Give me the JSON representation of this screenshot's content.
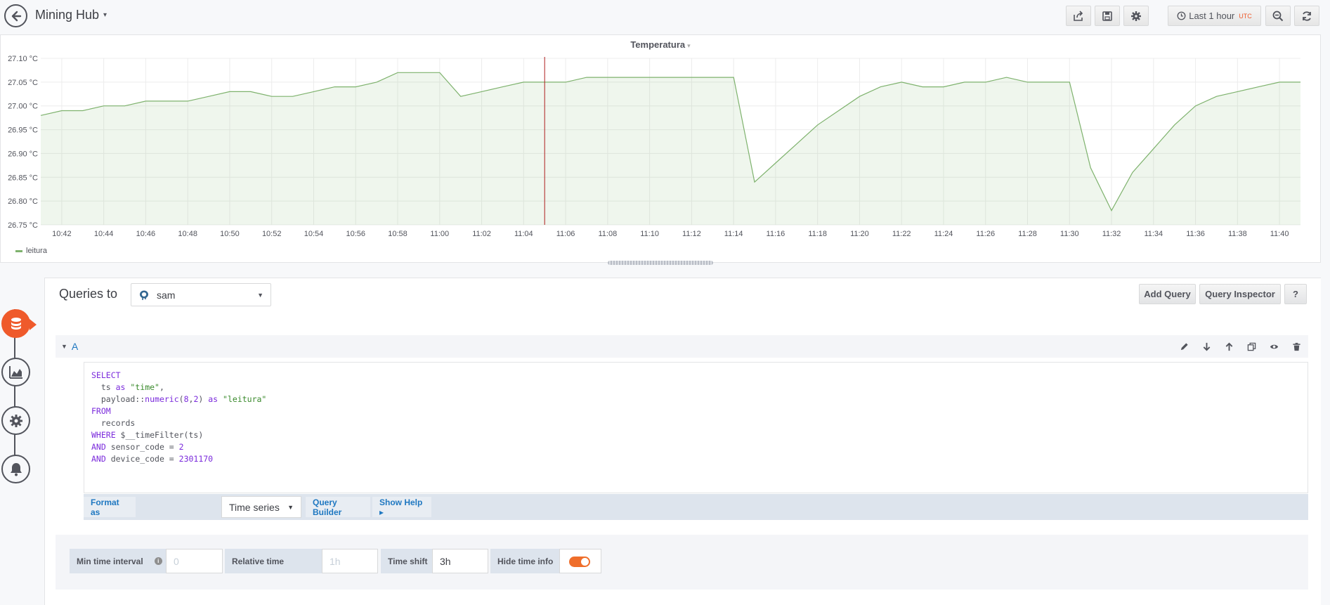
{
  "header": {
    "title": "Mining Hub",
    "time_range": "Last 1 hour",
    "timezone": "UTC"
  },
  "panel": {
    "title": "Temperatura",
    "legend": "leitura"
  },
  "chart_data": {
    "type": "area",
    "title": "Temperatura",
    "xlabel": "",
    "ylabel": "",
    "ylim": [
      26.75,
      27.1
    ],
    "y_ticks": [
      "27.10 °C",
      "27.05 °C",
      "27.00 °C",
      "26.95 °C",
      "26.90 °C",
      "26.85 °C",
      "26.80 °C",
      "26.75 °C"
    ],
    "x_ticks": [
      "10:42",
      "10:44",
      "10:46",
      "10:48",
      "10:50",
      "10:52",
      "10:54",
      "10:56",
      "10:58",
      "11:00",
      "11:02",
      "11:04",
      "11:06",
      "11:08",
      "11:10",
      "11:12",
      "11:14",
      "11:16",
      "11:18",
      "11:20",
      "11:22",
      "11:24",
      "11:26",
      "11:28",
      "11:30",
      "11:32",
      "11:34",
      "11:36",
      "11:38",
      "11:40"
    ],
    "x_range": [
      "10:41",
      "11:41"
    ],
    "grid": true,
    "legend_position": "bottom-left",
    "color": "#7eb26d",
    "crosshair_time": "11:05",
    "series": [
      {
        "name": "leitura",
        "x": [
          "10:41",
          "10:42",
          "10:43",
          "10:44",
          "10:45",
          "10:46",
          "10:47",
          "10:48",
          "10:49",
          "10:50",
          "10:51",
          "10:52",
          "10:53",
          "10:54",
          "10:55",
          "10:56",
          "10:57",
          "10:58",
          "10:59",
          "11:00",
          "11:01",
          "11:02",
          "11:03",
          "11:04",
          "11:05",
          "11:06",
          "11:07",
          "11:08",
          "11:09",
          "11:10",
          "11:11",
          "11:12",
          "11:13",
          "11:14",
          "11:15",
          "11:16",
          "11:17",
          "11:18",
          "11:19",
          "11:20",
          "11:21",
          "11:22",
          "11:23",
          "11:24",
          "11:25",
          "11:26",
          "11:27",
          "11:28",
          "11:29",
          "11:30",
          "11:31",
          "11:32",
          "11:33",
          "11:34",
          "11:35",
          "11:36",
          "11:37",
          "11:38",
          "11:39",
          "11:40",
          "11:41"
        ],
        "values": [
          26.98,
          26.99,
          26.99,
          27.0,
          27.0,
          27.01,
          27.01,
          27.01,
          27.02,
          27.03,
          27.03,
          27.02,
          27.02,
          27.03,
          27.04,
          27.04,
          27.05,
          27.07,
          27.07,
          27.07,
          27.02,
          27.03,
          27.04,
          27.05,
          27.05,
          27.05,
          27.06,
          27.06,
          27.06,
          27.06,
          27.06,
          27.06,
          27.06,
          27.06,
          26.84,
          26.88,
          26.92,
          26.96,
          26.99,
          27.02,
          27.04,
          27.05,
          27.04,
          27.04,
          27.05,
          27.05,
          27.06,
          27.05,
          27.05,
          27.05,
          26.87,
          26.78,
          26.86,
          26.91,
          26.96,
          27.0,
          27.02,
          27.03,
          27.04,
          27.05,
          27.05
        ]
      }
    ]
  },
  "editor": {
    "queries_to_label": "Queries to",
    "datasource": "sam",
    "add_query": "Add Query",
    "query_inspector": "Query Inspector",
    "help": "?",
    "query_letter": "A",
    "sql": {
      "l1_kw": "SELECT",
      "l2_a": "  ts ",
      "l2_kw": "as",
      "l2_str": "\"time\"",
      "l2_c": ",",
      "l3_a": "  payload::",
      "l3_fn": "numeric",
      "l3_b": "(",
      "l3_n1": "8",
      "l3_c": ",",
      "l3_n2": "2",
      "l3_d": ") ",
      "l3_kw": "as",
      "l3_str": "\"leitura\"",
      "l4_kw": "FROM",
      "l5": "  records",
      "l6_kw": "WHERE",
      "l6_b": " $__timeFilter(ts)",
      "l7_kw": "AND",
      "l7_b": " sensor_code = ",
      "l7_n": "2",
      "l8_kw": "AND",
      "l8_b": " device_code = ",
      "l8_n": "2301170"
    },
    "format_as_label": "Format as",
    "format_as_value": "Time series",
    "query_builder": "Query Builder",
    "show_help": "Show Help ▸"
  },
  "options": {
    "min_interval_label": "Min time interval",
    "min_interval_placeholder": "0",
    "relative_time_label": "Relative time",
    "relative_time_placeholder": "1h",
    "time_shift_label": "Time shift",
    "time_shift_value": "3h",
    "hide_time_info_label": "Hide time info",
    "hide_time_info": true
  }
}
